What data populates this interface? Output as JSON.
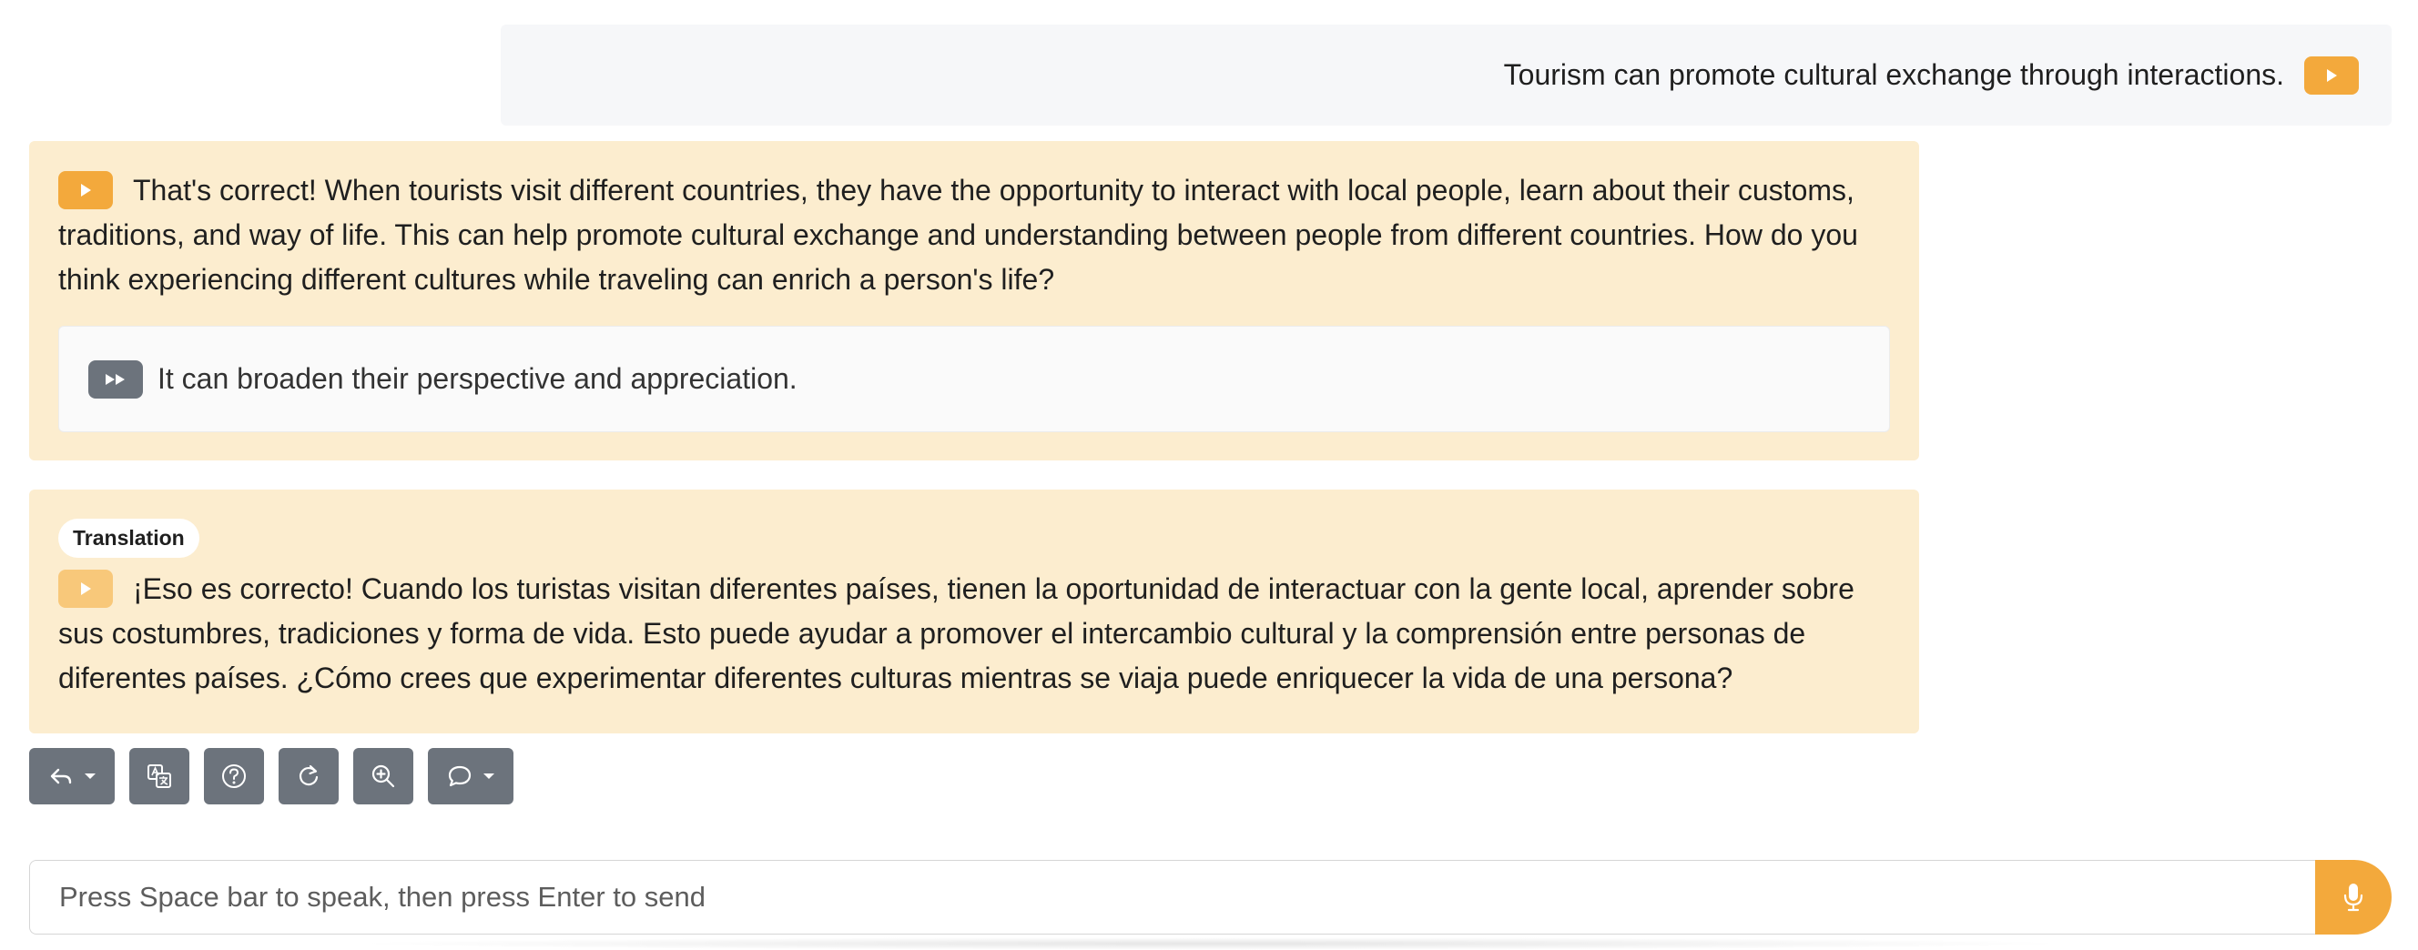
{
  "user_message": {
    "text": "Tourism can promote cultural exchange through interactions."
  },
  "assistant_message": {
    "text": "That's correct! When tourists visit different countries, they have the opportunity to interact with local people, learn about their customs, traditions, and way of life. This can help promote cultural exchange and understanding between people from different countries. How do you think experiencing different cultures while traveling can enrich a person's life?",
    "suggestion": "It can broaden their perspective and appreciation."
  },
  "translation": {
    "label": "Translation",
    "text": "¡Eso es correcto! Cuando los turistas visitan diferentes países, tienen la oportunidad de interactuar con la gente local, aprender sobre sus costumbres, tradiciones y forma de vida. Esto puede ayudar a promover el intercambio cultural y la comprensión entre personas de diferentes países. ¿Cómo crees que experimentar diferentes culturas mientras se viaja puede enriquecer la vida de una persona?"
  },
  "toolbar": {
    "buttons": [
      "reply-icon",
      "translate-icon",
      "help-icon",
      "refresh-icon",
      "zoom-in-icon",
      "comment-icon"
    ]
  },
  "input": {
    "placeholder": "Press Space bar to speak, then press Enter to send",
    "value": ""
  },
  "colors": {
    "accent": "#f3a93c",
    "accent_light": "#f8c87a",
    "bubble": "#fcedcf",
    "user_bubble": "#f6f7f9",
    "tool_button": "#6c737c"
  }
}
